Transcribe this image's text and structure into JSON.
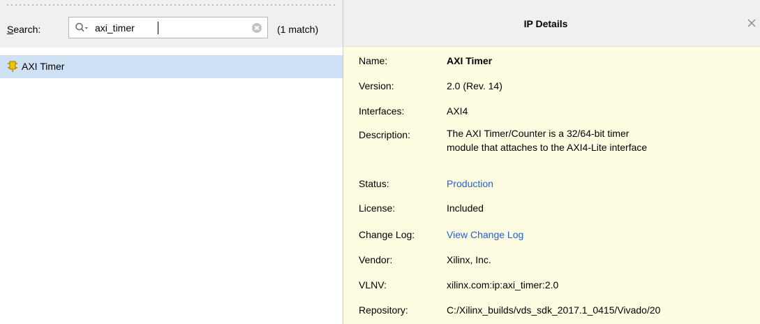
{
  "search_panel": {
    "label_underlined": "S",
    "label_rest": "earch:",
    "query": "axi_timer",
    "match_count": "(1 match)",
    "icons": {
      "search": "search-dropdown-icon",
      "clear": "clear-circle-icon"
    }
  },
  "results": [
    {
      "label": "AXI Timer",
      "icon": "ip-core-icon",
      "selected": true
    }
  ],
  "details": {
    "title": "IP Details",
    "close_icon": "close-icon",
    "fields": {
      "name": {
        "key": "Name:",
        "value": "AXI Timer"
      },
      "version": {
        "key": "Version:",
        "value": "2.0 (Rev. 14)"
      },
      "interfaces": {
        "key": "Interfaces:",
        "value": "AXI4"
      },
      "description": {
        "key": "Description:",
        "value_line1": "The AXI Timer/Counter is a 32/64-bit timer",
        "value_line2": "module that attaches to the AXI4-Lite interface"
      },
      "status": {
        "key": "Status:",
        "value": "Production"
      },
      "license": {
        "key": "License:",
        "value": "Included"
      },
      "change_log": {
        "key": "Change Log:",
        "value": "View Change Log"
      },
      "vendor": {
        "key": "Vendor:",
        "value": "Xilinx, Inc."
      },
      "vlnv": {
        "key": "VLNV:",
        "value": "xilinx.com:ip:axi_timer:2.0"
      },
      "repository": {
        "key": "Repository:",
        "value": "C:/Xilinx_builds/vds_sdk_2017.1_0415/Vivado/20"
      }
    }
  },
  "colors": {
    "selection": "#cfe1f5",
    "details_background": "#fffde1",
    "link": "#1e5fd6",
    "ip_icon": "#f2c400"
  }
}
